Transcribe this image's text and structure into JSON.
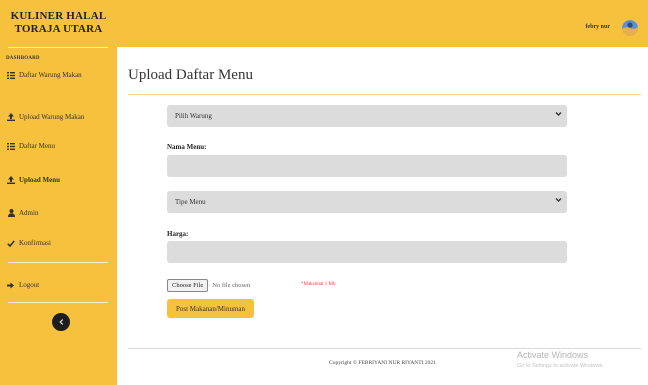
{
  "brand": {
    "line1": "KULINER HALAL",
    "line2": "TORAJA UTARA"
  },
  "sidebar": {
    "heading": "DASHBOARD",
    "items": [
      {
        "label": "Daftar Warung Makan",
        "icon": "list-icon"
      },
      {
        "label": "Upload Warung Makan",
        "icon": "upload-icon"
      },
      {
        "label": "Daftar Menu",
        "icon": "list-icon"
      },
      {
        "label": "Upload Menu",
        "icon": "upload-icon",
        "active": true
      },
      {
        "label": "Admin",
        "icon": "user-icon"
      },
      {
        "label": "Konfirmasi",
        "icon": "check-icon"
      },
      {
        "label": "Logout",
        "icon": "logout-icon"
      }
    ],
    "toggle_icon": "chevron-left-icon"
  },
  "topbar": {
    "user_name": "febry nur",
    "avatar": "avatar-icon"
  },
  "page": {
    "title": "Upload Daftar Menu"
  },
  "form": {
    "warung_select": {
      "value": "Pilih Warung"
    },
    "nama_menu": {
      "label": "Nama Menu:",
      "value": ""
    },
    "tipe_select": {
      "value": "Tipe Menu"
    },
    "harga": {
      "label": "Harga:",
      "value": ""
    },
    "file": {
      "button_label": "Choose File",
      "status": "No file chosen",
      "hint": "*Maksimal 1 Mb"
    },
    "submit_label": "Post Makanan/Minuman"
  },
  "footer": {
    "copyright": "Copyright © FEBRIYANI NUR RIYANTI 2021",
    "watermark_title": "Activate Windows",
    "watermark_sub": "Go to Settings to activate Windows."
  },
  "colors": {
    "accent": "#f6c23e",
    "field_bg": "#dcdcdc",
    "hint": "#e04646"
  }
}
